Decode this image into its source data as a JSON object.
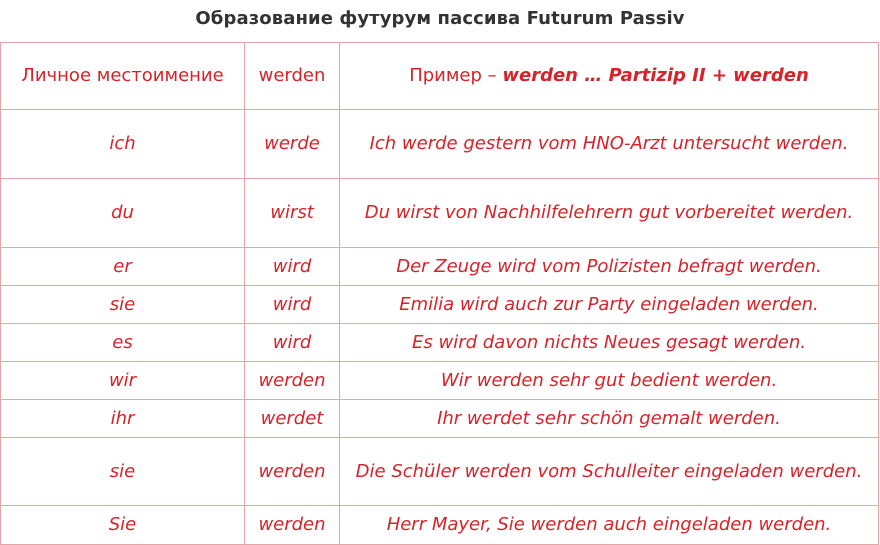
{
  "title": "Образование футурум пассива Futurum Passiv",
  "header": {
    "col1": "Личное местоимение",
    "col2": "werden",
    "col3_prefix": "Пример – ",
    "col3_formula": "werden … Partizip II + werden"
  },
  "rows": [
    {
      "pronoun": "ich",
      "werden": "werde",
      "example": "Ich werde gestern vom HNO-Arzt untersucht werden."
    },
    {
      "pronoun": "du",
      "werden": "wirst",
      "example": "Du wirst von Nachhilfelehrern gut vorbereitet werden."
    },
    {
      "pronoun": "er",
      "werden": "wird",
      "example": "Der Zeuge wird vom Polizisten befragt werden."
    },
    {
      "pronoun": "sie",
      "werden": "wird",
      "example": "Emilia wird auch zur Party eingeladen werden."
    },
    {
      "pronoun": "es",
      "werden": "wird",
      "example": "Es wird davon nichts Neues gesagt werden."
    },
    {
      "pronoun": "wir",
      "werden": "werden",
      "example": "Wir werden sehr gut bedient werden."
    },
    {
      "pronoun": "ihr",
      "werden": "werdet",
      "example": "Ihr werdet sehr schön gemalt werden."
    },
    {
      "pronoun": "sie",
      "werden": "werden",
      "example": "Die Schüler werden vom Schulleiter eingeladen werden."
    },
    {
      "pronoun": "Sie",
      "werden": "werden",
      "example": "Herr Mayer, Sie werden auch eingeladen werden."
    }
  ],
  "colors": {
    "text_red": "#d6232a",
    "border": "#e6a6a8",
    "title": "#333333"
  }
}
